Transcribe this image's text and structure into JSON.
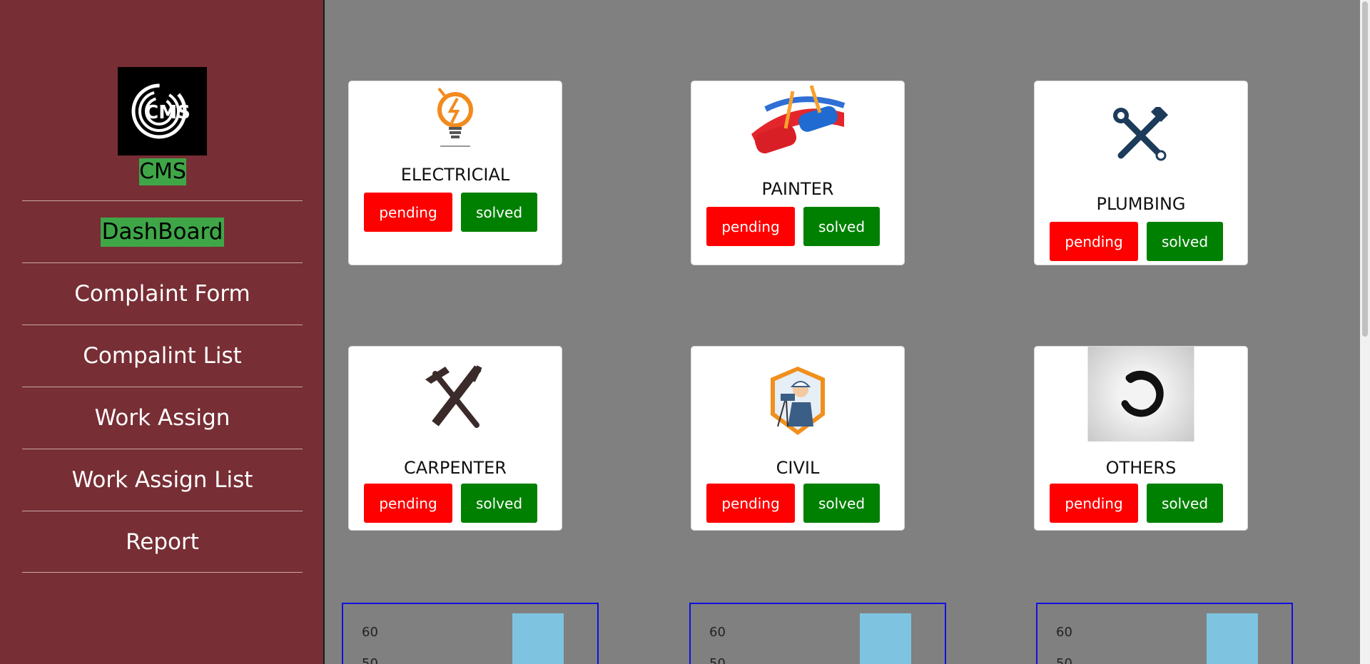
{
  "sidebar": {
    "brand": "CMS",
    "logo_text": "CMS",
    "items": [
      {
        "label": "DashBoard",
        "active": true
      },
      {
        "label": "Complaint Form"
      },
      {
        "label": "Compalint List"
      },
      {
        "label": "Work Assign"
      },
      {
        "label": "Work Assign List"
      },
      {
        "label": "Report"
      }
    ]
  },
  "cards": [
    {
      "title": "ELECTRICIAL",
      "icon": "electrical-bulb-icon",
      "pending": "pending",
      "solved": "solved"
    },
    {
      "title": "PAINTER",
      "icon": "paint-roller-icon",
      "pending": "pending",
      "solved": "solved"
    },
    {
      "title": "PLUMBING",
      "icon": "wrench-icon",
      "pending": "pending",
      "solved": "solved"
    },
    {
      "title": "CARPENTER",
      "icon": "hammer-saw-icon",
      "pending": "pending",
      "solved": "solved"
    },
    {
      "title": "CIVIL",
      "icon": "surveyor-icon",
      "pending": "pending",
      "solved": "solved"
    },
    {
      "title": "OTHERS",
      "icon": "loading-icon",
      "pending": "pending",
      "solved": "solved"
    }
  ],
  "charts": [
    {
      "ticks": [
        "60",
        "50"
      ]
    },
    {
      "ticks": [
        "60",
        "50"
      ]
    },
    {
      "ticks": [
        "60",
        "50"
      ]
    }
  ],
  "colors": {
    "sidebar": "#772e34",
    "active": "#3fa648",
    "pending": "#ff0000",
    "solved": "#008000",
    "bar": "#7ec4e1",
    "chart_border": "#1010e0"
  }
}
